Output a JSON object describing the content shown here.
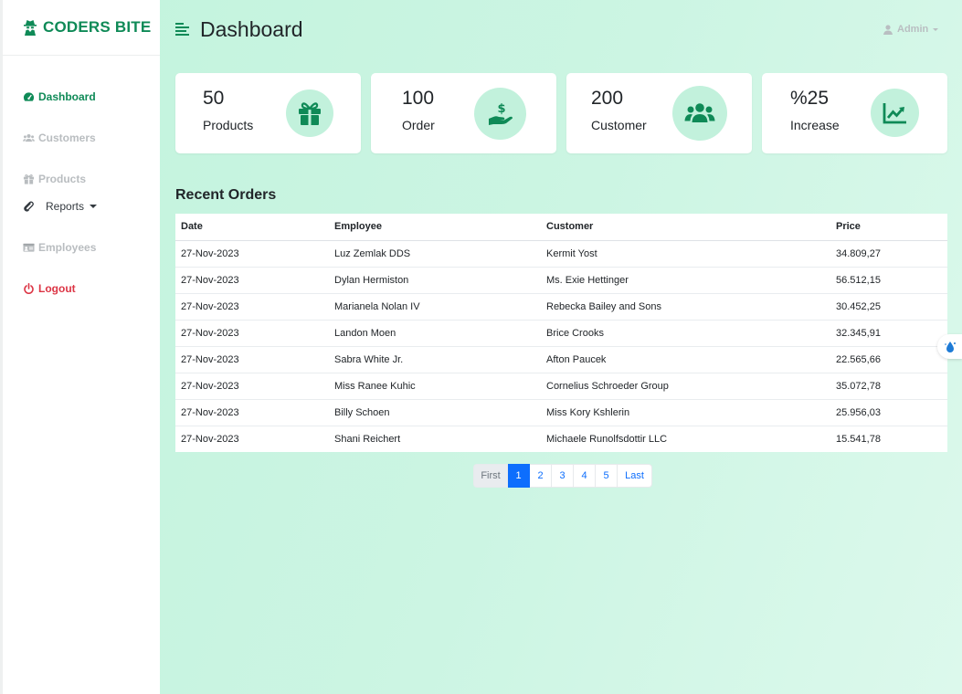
{
  "brand": {
    "name": "CODERS BITE",
    "icon": "user-secret-icon"
  },
  "sidebar": {
    "items": [
      {
        "label": "Dashboard",
        "icon": "tachometer-icon",
        "active": true
      },
      {
        "label": "Customers",
        "icon": "users-icon"
      },
      {
        "label": "Products",
        "icon": "gift-icon"
      },
      {
        "label": "Reports",
        "icon": "paperclip-icon",
        "dropdown": true
      },
      {
        "label": "Employees",
        "icon": "id-card-icon"
      },
      {
        "label": "Logout",
        "icon": "power-icon"
      }
    ]
  },
  "header": {
    "title": "Dashboard",
    "user": "Admin"
  },
  "cards": [
    {
      "value": "50",
      "label": "Products",
      "icon": "gift-icon"
    },
    {
      "value": "100",
      "label": "Order",
      "icon": "hand-dollar-icon"
    },
    {
      "value": "200",
      "label": "Customer",
      "icon": "users-icon"
    },
    {
      "value": "%25",
      "label": "Increase",
      "icon": "chart-line-icon"
    }
  ],
  "orders": {
    "title": "Recent Orders",
    "columns": [
      "Date",
      "Employee",
      "Customer",
      "Price"
    ],
    "rows": [
      [
        "27-Nov-2023",
        "Luz Zemlak DDS",
        "Kermit Yost",
        "34.809,27"
      ],
      [
        "27-Nov-2023",
        "Dylan Hermiston",
        "Ms. Exie Hettinger",
        "56.512,15"
      ],
      [
        "27-Nov-2023",
        "Marianela Nolan IV",
        "Rebecka Bailey and Sons",
        "30.452,25"
      ],
      [
        "27-Nov-2023",
        "Landon Moen",
        "Brice Crooks",
        "32.345,91"
      ],
      [
        "27-Nov-2023",
        "Sabra White Jr.",
        "Afton Paucek",
        "22.565,66"
      ],
      [
        "27-Nov-2023",
        "Miss Ranee Kuhic",
        "Cornelius Schroeder Group",
        "35.072,78"
      ],
      [
        "27-Nov-2023",
        "Billy Schoen",
        "Miss Kory Kshlerin",
        "25.956,03"
      ],
      [
        "27-Nov-2023",
        "Shani Reichert",
        "Michaele Runolfsdottir LLC",
        "15.541,78"
      ]
    ]
  },
  "pagination": {
    "first": "First",
    "pages": [
      "1",
      "2",
      "3",
      "4",
      "5"
    ],
    "last": "Last",
    "current": "1"
  },
  "colors": {
    "brand": "#0f8a57",
    "accent": "#0d6efd",
    "danger": "#dc3545",
    "icon_bg": "#c2f1dc"
  }
}
